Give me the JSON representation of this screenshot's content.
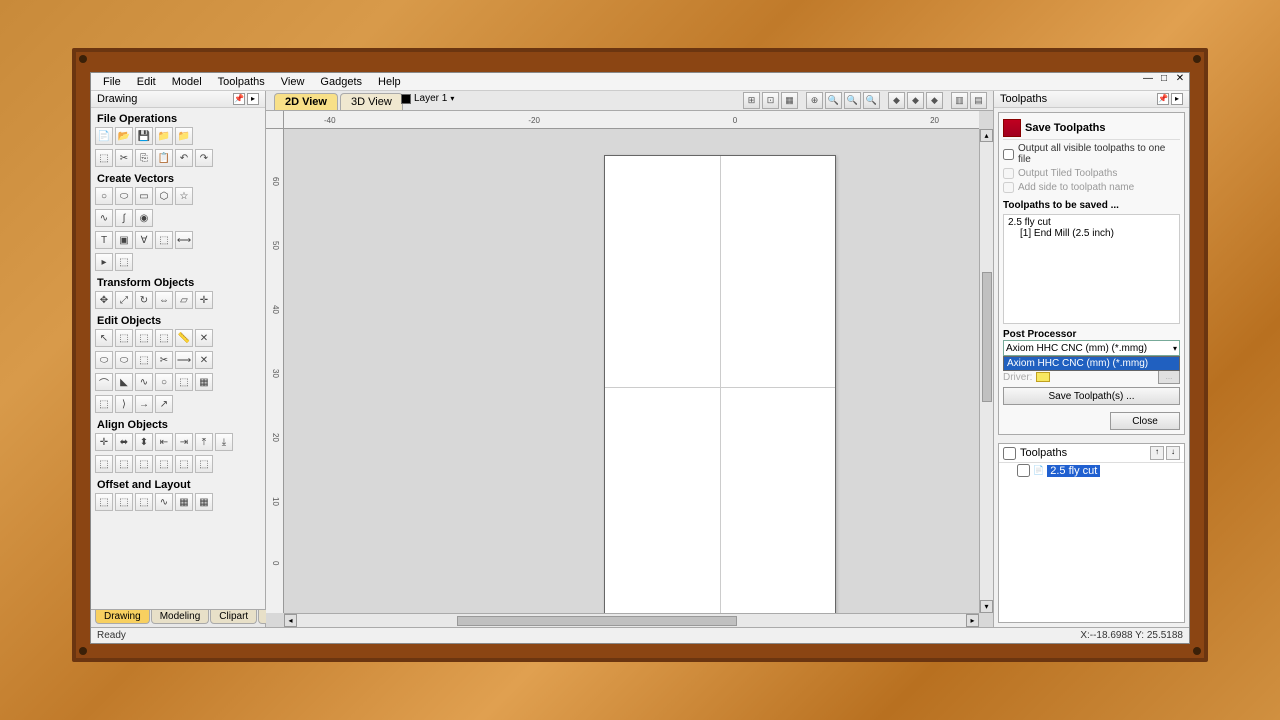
{
  "menu": [
    "File",
    "Edit",
    "Model",
    "Toolpaths",
    "View",
    "Gadgets",
    "Help"
  ],
  "left": {
    "title": "Drawing",
    "sections": {
      "file_ops": "File Operations",
      "create_vectors": "Create Vectors",
      "transform": "Transform Objects",
      "edit": "Edit Objects",
      "align": "Align Objects",
      "offset": "Offset and Layout"
    }
  },
  "tabs2d": {
    "2d": "2D View",
    "3d": "3D View"
  },
  "layer": "Layer 1",
  "ruler_h": [
    "-40",
    "-20",
    "0",
    "20"
  ],
  "ruler_v": [
    "60",
    "50",
    "40",
    "30",
    "20",
    "10",
    "0"
  ],
  "right": {
    "title": "Toolpaths",
    "save_title": "Save Toolpaths",
    "chk_output_all": "Output all visible toolpaths to one file",
    "chk_tiled": "Output Tiled Toolpaths",
    "chk_addside": "Add side to toolpath name",
    "to_be_saved": "Toolpaths to be saved ...",
    "tp_name": "2.5 fly cut",
    "tp_tool": "[1] End Mill (2.5 inch)",
    "pp_label": "Post Processor",
    "pp_selected": "Axiom HHC CNC (mm) (*.mmg)",
    "pp_option": "Axiom HHC CNC (mm) (*.mmg)",
    "driver_label": "Driver:",
    "save_btn": "Save Toolpath(s) ...",
    "close_btn": "Close",
    "tree_title": "Toolpaths",
    "tree_item": "2.5 fly cut"
  },
  "bottom_tabs": [
    "Drawing",
    "Modeling",
    "Clipart",
    "Layers"
  ],
  "status": {
    "ready": "Ready",
    "coords": "X:--18.6988 Y: 25.5188"
  }
}
